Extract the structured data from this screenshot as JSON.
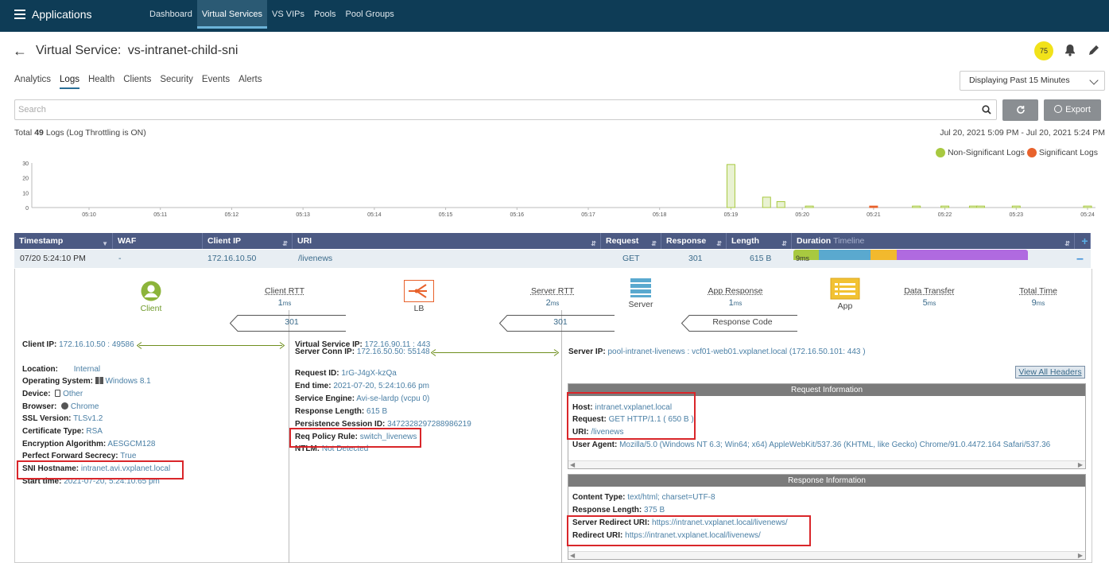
{
  "header": {
    "app_title": "Applications",
    "nav": [
      "Dashboard",
      "Virtual Services",
      "VS VIPs",
      "Pools",
      "Pool Groups"
    ],
    "active_nav": "Virtual Services"
  },
  "page": {
    "title_prefix": "Virtual Service:",
    "title_name": "vs-intranet-child-sni",
    "health_score": "75",
    "tabs": [
      "Analytics",
      "Logs",
      "Health",
      "Clients",
      "Security",
      "Events",
      "Alerts"
    ],
    "active_tab": "Logs",
    "time_range": "Displaying Past 15 Minutes"
  },
  "toolbar": {
    "search_placeholder": "Search",
    "export_label": "Export"
  },
  "summary": {
    "total_label": "Total",
    "total_count": "49",
    "logs_label": "Logs (Log Throttling is ON)",
    "time_window": "Jul 20, 2021 5:09 PM - Jul 20, 2021 5:24 PM"
  },
  "legend": {
    "non_significant": "Non-Significant Logs",
    "significant": "Significant Logs",
    "non_significant_color": "#a8c940",
    "significant_color": "#e8622c"
  },
  "chart_data": {
    "type": "bar",
    "y_ticks": [
      "30",
      "20",
      "10",
      "0"
    ],
    "x_ticks": [
      "05:10",
      "05:11",
      "05:12",
      "05:13",
      "05:14",
      "05:15",
      "05:16",
      "05:17",
      "05:18",
      "05:19",
      "05:20",
      "05:21",
      "05:22",
      "05:23",
      "05:24"
    ],
    "ylim": [
      0,
      30
    ],
    "series": [
      {
        "name": "Non-Significant Logs",
        "color": "#a8c940",
        "points": [
          {
            "x": "05:19",
            "v": 29
          },
          {
            "x": "05:19.5",
            "v": 7
          },
          {
            "x": "05:19.7",
            "v": 4
          },
          {
            "x": "05:20.1",
            "v": 1
          },
          {
            "x": "05:21.6",
            "v": 1
          },
          {
            "x": "05:22",
            "v": 1
          },
          {
            "x": "05:22.4",
            "v": 1
          },
          {
            "x": "05:22.5",
            "v": 1
          },
          {
            "x": "05:23",
            "v": 1
          },
          {
            "x": "05:24",
            "v": 1
          }
        ]
      },
      {
        "name": "Significant Logs",
        "color": "#e8622c",
        "points": [
          {
            "x": "05:21",
            "v": 1
          }
        ]
      }
    ]
  },
  "table": {
    "headers": {
      "timestamp": "Timestamp",
      "waf": "WAF",
      "client_ip": "Client IP",
      "uri": "URI",
      "request": "Request",
      "response": "Response",
      "length": "Length",
      "duration": "Duration",
      "timeline": "Timeline"
    },
    "row": {
      "timestamp": "07/20 5:24:10 PM",
      "waf": "-",
      "client_ip": "172.16.10.50",
      "uri": "/livenews",
      "request": "GET",
      "response": "301",
      "length": "615 B",
      "duration_label": "9ms",
      "duration_segments": [
        {
          "color": "#a8c940",
          "fraction": 0.11
        },
        {
          "color": "#5aa9cf",
          "fraction": 0.22
        },
        {
          "color": "#f2b92d",
          "fraction": 0.11
        },
        {
          "color": "#b06ae0",
          "fraction": 0.56
        }
      ]
    }
  },
  "flow": {
    "client": "Client",
    "lb": "LB",
    "server": "Server",
    "app": "App",
    "client_rtt_label": "Client RTT",
    "client_rtt_value": "1",
    "server_rtt_label": "Server RTT",
    "server_rtt_value": "2",
    "app_response_label": "App Response",
    "app_response_value": "1",
    "data_transfer_label": "Data Transfer",
    "data_transfer_value": "5",
    "total_time_label": "Total Time",
    "total_time_value": "9",
    "unit": "ms",
    "code_client": "301",
    "code_server": "301",
    "response_code_label": "Response Code"
  },
  "client_details": {
    "client_ip_label": "Client IP:",
    "client_ip": "172.16.10.50 : 49586",
    "location_label": "Location:",
    "location": "Internal",
    "os_label": "Operating System:",
    "os": "Windows 8.1",
    "device_label": "Device:",
    "device": "Other",
    "browser_label": "Browser:",
    "browser": "Chrome",
    "ssl_label": "SSL Version:",
    "ssl": "TLSv1.2",
    "cert_label": "Certificate Type:",
    "cert": "RSA",
    "enc_label": "Encryption Algorithm:",
    "enc": "AESGCM128",
    "pfs_label": "Perfect Forward Secrecy:",
    "pfs": "True",
    "sni_label": "SNI Hostname:",
    "sni": "intranet.avi.vxplanet.local",
    "start_label": "Start time:",
    "start": "2021-07-20, 5:24:10.65 pm"
  },
  "lb_details": {
    "vip_label": "Virtual Service IP:",
    "vip": "172.16.90.11 : 443",
    "conn_label": "Server Conn IP:",
    "conn": "172.16.50.50: 55148",
    "reqid_label": "Request ID:",
    "reqid": "1rG-J4gX-kzQa",
    "end_label": "End time:",
    "end": "2021-07-20, 5:24:10.66 pm",
    "se_label": "Service Engine:",
    "se": "Avi-se-lardp",
    "se_suffix": "(vcpu 0)",
    "resplen_label": "Response Length:",
    "resplen": "615 B",
    "persist_label": "Persistence Session ID:",
    "persist": "3472328297288986219",
    "policy_label": "Req Policy Rule:",
    "policy": "switch_livenews",
    "ntlm_label": "NTLM:",
    "ntlm": "Not Detected"
  },
  "server_details": {
    "server_ip_label": "Server IP:",
    "server_ip": "pool-intranet-livenews : vcf01-web01.vxplanet.local (172.16.50.101: 443 )",
    "view_all": "View All Headers",
    "request_info_title": "Request Information",
    "host_label": "Host:",
    "host": "intranet.vxplanet.local",
    "request_label": "Request:",
    "request": "GET HTTP/1.1 ( 650 B )",
    "uri_label": "URI:",
    "uri": "/livenews",
    "ua_label": "User Agent:",
    "ua": "Mozilla/5.0 (Windows NT 6.3; Win64; x64) AppleWebKit/537.36 (KHTML, like Gecko) Chrome/91.0.4472.164 Safari/537.36",
    "response_info_title": "Response Information",
    "ctype_label": "Content Type:",
    "ctype": "text/html; charset=UTF-8",
    "rlen_label": "Response Length:",
    "rlen": "375 B",
    "sredir_label": "Server Redirect URI:",
    "sredir": "https://intranet.vxplanet.local/livenews/",
    "redir_label": "Redirect URI:",
    "redir": "https://intranet.vxplanet.local/livenews/"
  }
}
